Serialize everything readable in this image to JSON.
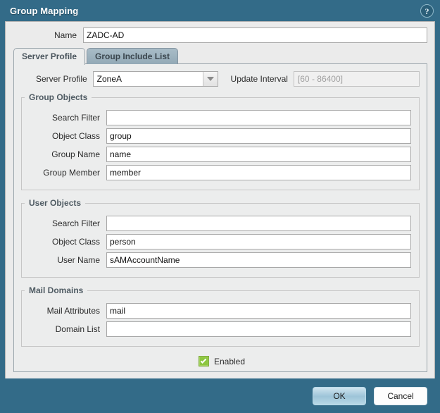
{
  "dialog": {
    "title": "Group Mapping",
    "help_icon": "help-circle-icon",
    "accent_color": "#336b88",
    "panel_color": "#ebebeb"
  },
  "name_field": {
    "label": "Name",
    "value": "ZADC-AD",
    "placeholder": ""
  },
  "tabs": [
    {
      "label": "Server Profile",
      "active": true
    },
    {
      "label": "Group Include List",
      "active": false
    }
  ],
  "server_profile_row": {
    "profile_label": "Server Profile",
    "profile_value": "ZoneA",
    "dropdown_icon": "chevron-down-icon",
    "update_interval_label": "Update Interval",
    "update_interval_value": "",
    "update_interval_placeholder": "[60 - 86400]",
    "update_interval_disabled": true
  },
  "group_objects": {
    "legend": "Group Objects",
    "fields": [
      {
        "label": "Search Filter",
        "value": ""
      },
      {
        "label": "Object Class",
        "value": "group"
      },
      {
        "label": "Group Name",
        "value": "name"
      },
      {
        "label": "Group Member",
        "value": "member"
      }
    ]
  },
  "user_objects": {
    "legend": "User Objects",
    "fields": [
      {
        "label": "Search Filter",
        "value": ""
      },
      {
        "label": "Object Class",
        "value": "person"
      },
      {
        "label": "User Name",
        "value": "sAMAccountName"
      }
    ]
  },
  "mail_domains": {
    "legend": "Mail Domains",
    "fields": [
      {
        "label": "Mail Attributes",
        "value": "mail"
      },
      {
        "label": "Domain List",
        "value": ""
      }
    ]
  },
  "enabled": {
    "label": "Enabled",
    "checked": true,
    "check_color": "#8cc63f"
  },
  "footer": {
    "ok_label": "OK",
    "cancel_label": "Cancel"
  }
}
